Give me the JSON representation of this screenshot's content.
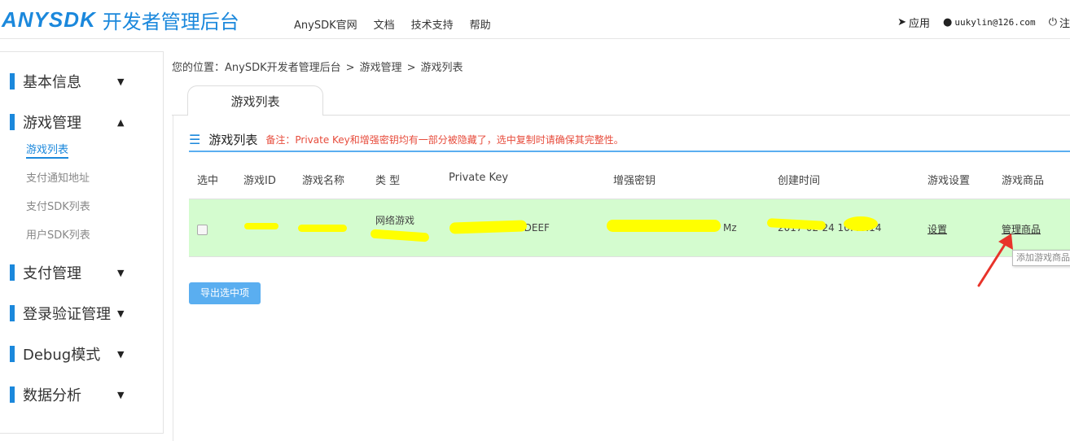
{
  "header": {
    "brand": "ANYSDK",
    "subtitle": "开发者管理后台",
    "nav": [
      "AnySDK官网",
      "文档",
      "技术支持",
      "帮助"
    ],
    "apps_label": "应用",
    "user_email": "uukylin@126.com",
    "logout_label": "注"
  },
  "sidebar": {
    "menus": [
      {
        "label": "基本信息",
        "arrow": "▼"
      },
      {
        "label": "游戏管理",
        "arrow": "▲"
      },
      {
        "label": "支付管理",
        "arrow": "▼"
      },
      {
        "label": "登录验证管理",
        "arrow": "▼"
      },
      {
        "label": "Debug模式",
        "arrow": "▼"
      },
      {
        "label": "数据分析",
        "arrow": "▼"
      }
    ],
    "game_submenu": [
      "游戏列表",
      "支付通知地址",
      "支付SDK列表",
      "用户SDK列表"
    ]
  },
  "breadcrumb": {
    "prefix": "您的位置：",
    "items": [
      "AnySDK开发者管理后台",
      "游戏管理",
      "游戏列表"
    ],
    "sep": ">"
  },
  "tab": {
    "label": "游戏列表"
  },
  "panel": {
    "title": "游戏列表",
    "note": "备注：Private Key和增强密钥均有一部分被隐藏了，选中复制时请确保其完整性。"
  },
  "table": {
    "headers": [
      "选中",
      "游戏ID",
      "游戏名称",
      "类 型",
      "Private Key",
      "增强密钥",
      "创建时间",
      "游戏设置",
      "游戏商品"
    ],
    "row": {
      "type": "网络游戏",
      "private_key_tail": "9DEEF",
      "enhanced_key_tail": "Mz",
      "created": "2017-02-24 10:40:14",
      "settings_link": "设置",
      "products_link": "管理商品"
    }
  },
  "tooltip": "添加游戏商品",
  "export_button": "导出选中项",
  "colors": {
    "accent": "#1b88dc",
    "row_highlight": "#d4fccf",
    "note": "#e74c3c",
    "annotation": "#e8332a"
  }
}
